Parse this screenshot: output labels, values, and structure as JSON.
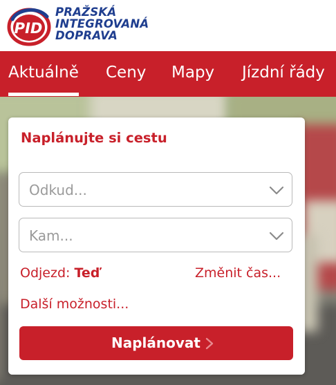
{
  "brand": {
    "logo_text": "PID",
    "lines": [
      "PRAŽSKÁ",
      "INTEGROVANÁ",
      "DOPRAVA"
    ]
  },
  "nav": {
    "items": [
      {
        "label": "Aktuálně",
        "active": true
      },
      {
        "label": "Ceny",
        "active": false
      },
      {
        "label": "Mapy",
        "active": false
      },
      {
        "label": "Jízdní řády",
        "active": false
      }
    ]
  },
  "planner": {
    "title": "Naplánujte si cestu",
    "from_placeholder": "Odkud...",
    "to_placeholder": "Kam...",
    "departure_label": "Odjezd:",
    "departure_value": "Teď",
    "change_time": "Změnit čas...",
    "more_options": "Další možnosti...",
    "submit": "Naplánovat"
  },
  "colors": {
    "brand_red": "#c8202a",
    "brand_blue": "#1f3e8f"
  },
  "icons": {
    "select_chevron": "chevron-down-icon",
    "submit_arrow": "chevron-right-icon"
  }
}
